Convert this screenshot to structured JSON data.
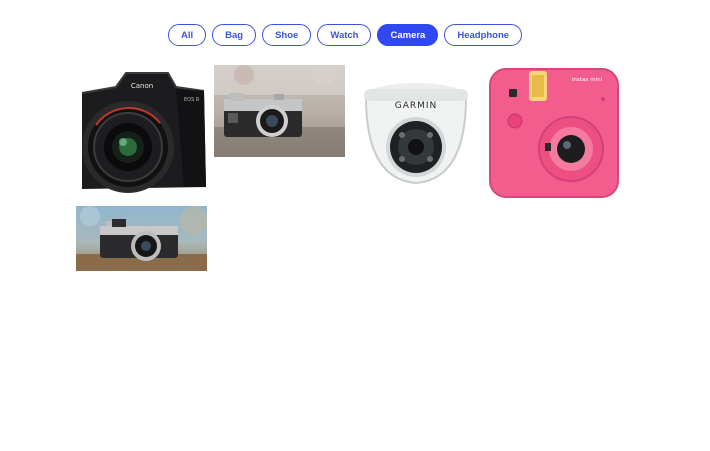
{
  "filters": {
    "items": [
      {
        "label": "All",
        "active": false
      },
      {
        "label": "Bag",
        "active": false
      },
      {
        "label": "Shoe",
        "active": false
      },
      {
        "label": "Watch",
        "active": false
      },
      {
        "label": "Camera",
        "active": true
      },
      {
        "label": "Headphone",
        "active": false
      }
    ]
  },
  "gallery": {
    "items": [
      {
        "name": "canon-dslr-camera",
        "brand_text": "Canon",
        "model_text": "EOS R"
      },
      {
        "name": "vintage-camera-on-table"
      },
      {
        "name": "garmin-dome-camera",
        "brand_text": "GARMIN"
      },
      {
        "name": "pink-instant-camera",
        "brand_text": "instax mini"
      },
      {
        "name": "mirrorless-camera-on-rock"
      }
    ]
  },
  "colors": {
    "accent": "#2f48f0",
    "pink": "#f25d8e"
  }
}
